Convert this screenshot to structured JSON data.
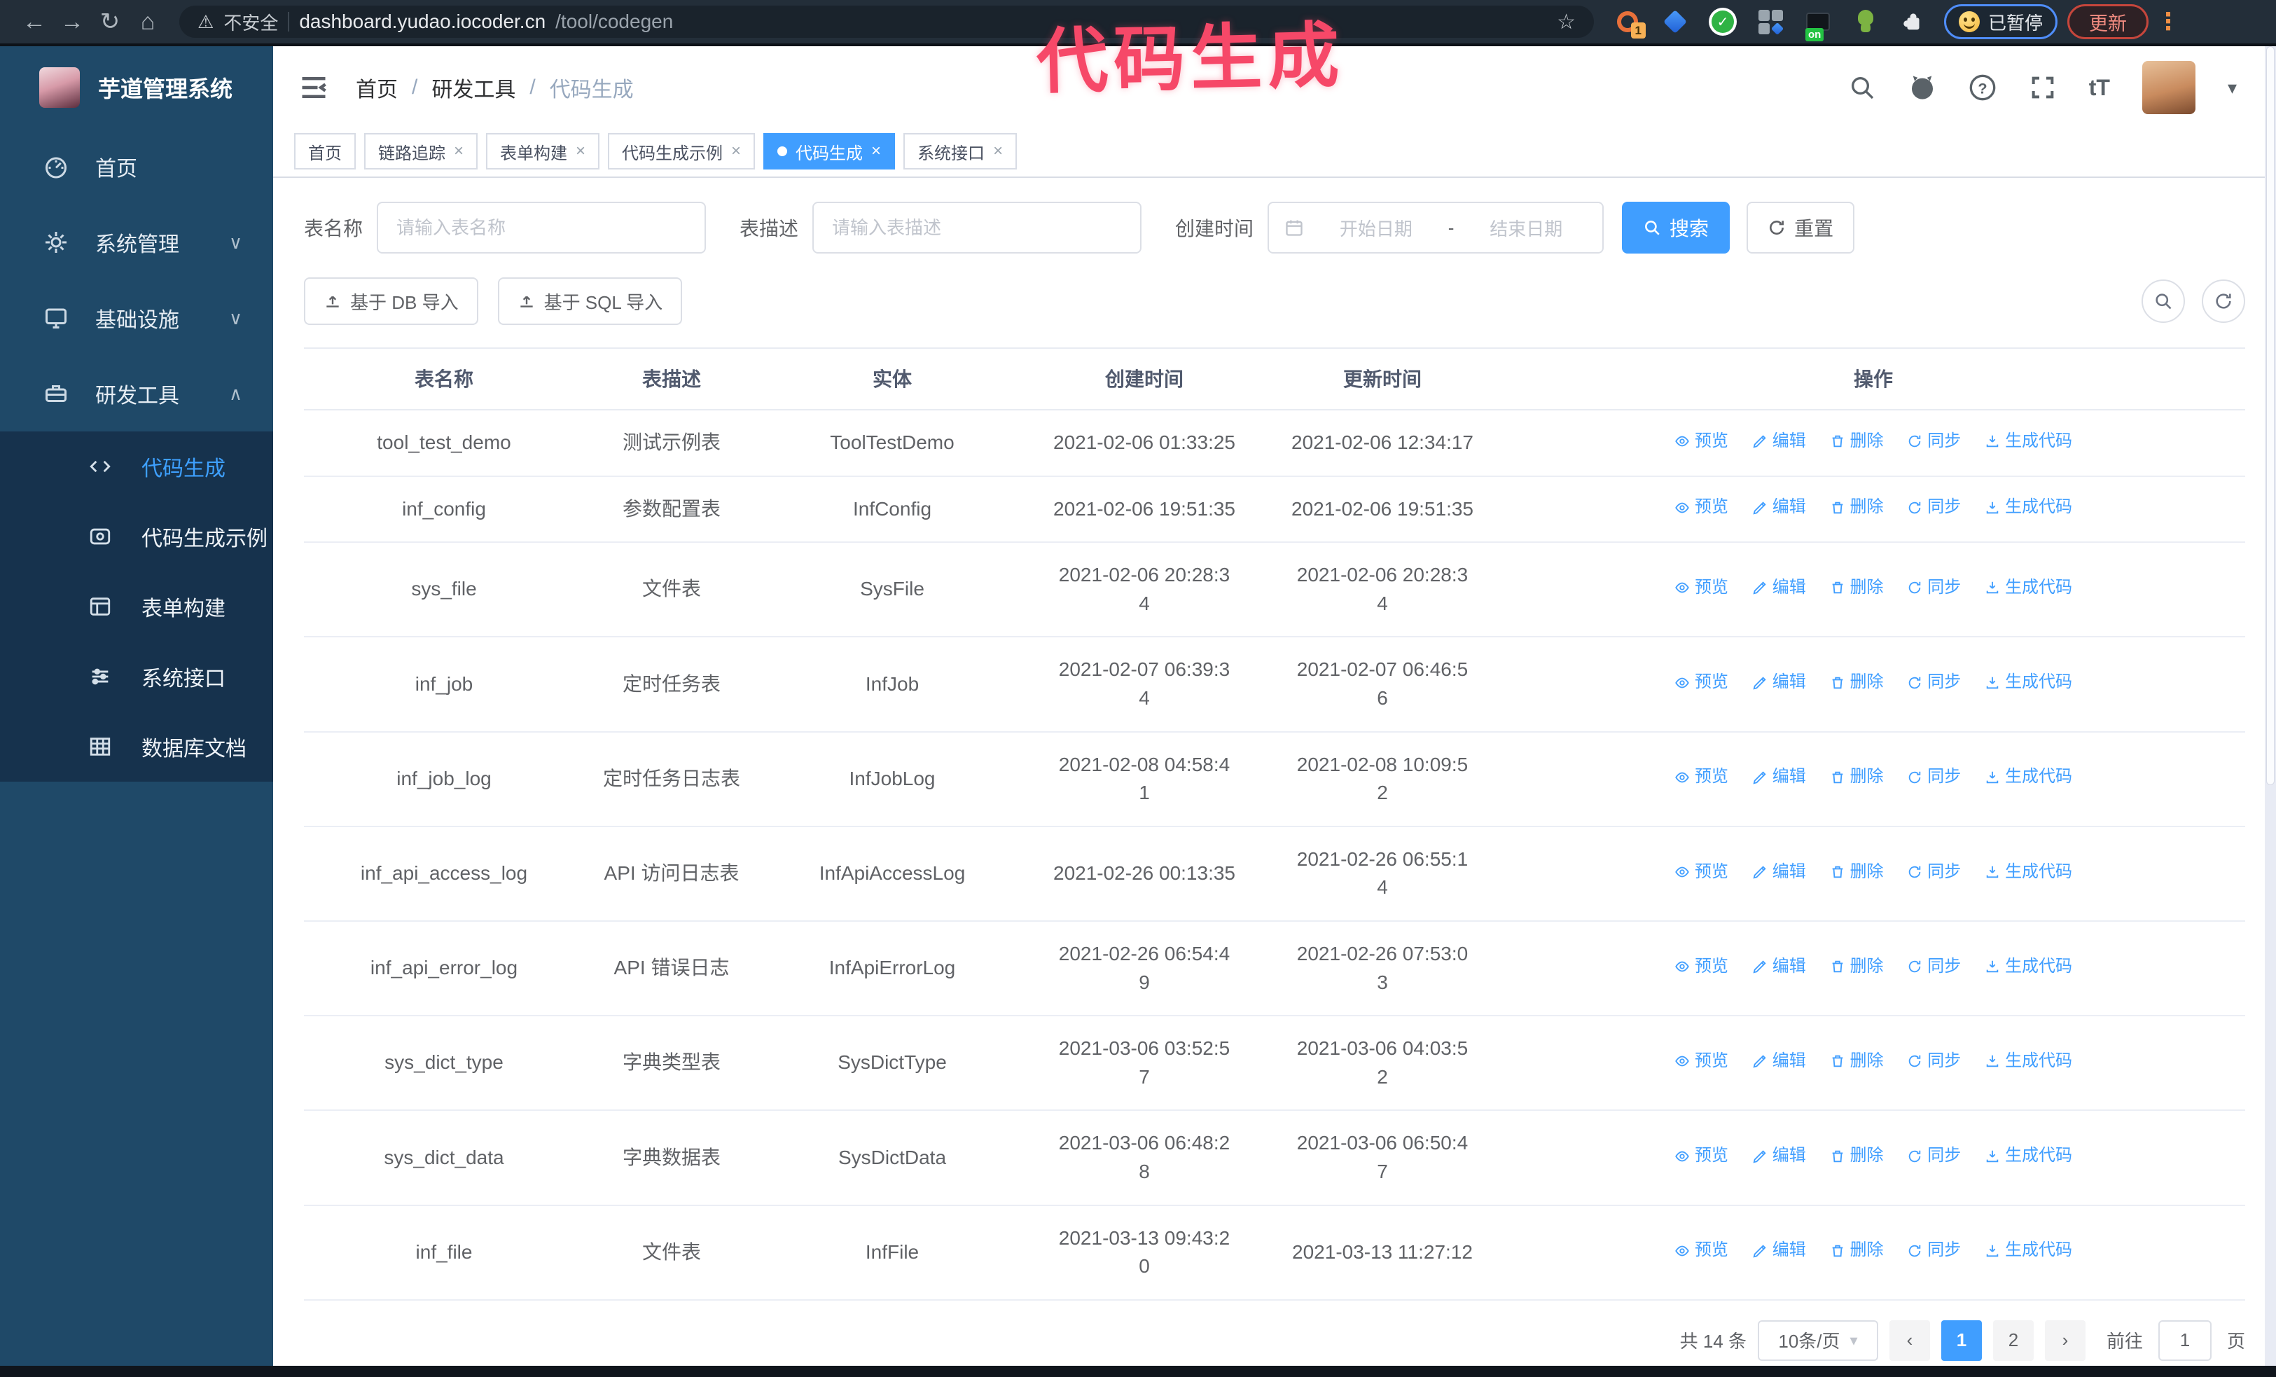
{
  "browser": {
    "security_label": "不安全",
    "url_domain": "dashboard.yudao.iocoder.cn",
    "url_path": "/tool/codegen",
    "extension_badge_count": "1",
    "extension_badge_on": "on",
    "extension_check": "✓",
    "paused_badge": "已暂停",
    "update_button": "更新"
  },
  "watermark": "代码生成",
  "app": {
    "title": "芋道管理系统",
    "breadcrumb": [
      "首页",
      "研发工具",
      "代码生成"
    ]
  },
  "sidebar": {
    "items": [
      {
        "label": "首页"
      },
      {
        "label": "系统管理"
      },
      {
        "label": "基础设施"
      },
      {
        "label": "研发工具"
      }
    ],
    "subitems": [
      {
        "label": "代码生成"
      },
      {
        "label": "代码生成示例"
      },
      {
        "label": "表单构建"
      },
      {
        "label": "系统接口"
      },
      {
        "label": "数据库文档"
      }
    ]
  },
  "tabs": [
    {
      "label": "首页"
    },
    {
      "label": "链路追踪"
    },
    {
      "label": "表单构建"
    },
    {
      "label": "代码生成示例"
    },
    {
      "label": "代码生成"
    },
    {
      "label": "系统接口"
    }
  ],
  "filters": {
    "table_name_label": "表名称",
    "table_name_placeholder": "请输入表名称",
    "table_desc_label": "表描述",
    "table_desc_placeholder": "请输入表描述",
    "create_time_label": "创建时间",
    "date_start_placeholder": "开始日期",
    "date_separator": "-",
    "date_end_placeholder": "结束日期",
    "search_button": "搜索",
    "reset_button": "重置"
  },
  "toolbar": {
    "import_db": "基于 DB 导入",
    "import_sql": "基于 SQL 导入"
  },
  "table": {
    "headers": [
      "表名称",
      "表描述",
      "实体",
      "创建时间",
      "更新时间",
      "操作"
    ],
    "actions": [
      "预览",
      "编辑",
      "删除",
      "同步",
      "生成代码"
    ],
    "rows": [
      {
        "name": "tool_test_demo",
        "desc": "测试示例表",
        "entity": "ToolTestDemo",
        "created": "2021-02-06 01:33:25",
        "updated": "2021-02-06 12:34:17"
      },
      {
        "name": "inf_config",
        "desc": "参数配置表",
        "entity": "InfConfig",
        "created": "2021-02-06 19:51:35",
        "updated": "2021-02-06 19:51:35"
      },
      {
        "name": "sys_file",
        "desc": "文件表",
        "entity": "SysFile",
        "created": "2021-02-06 20:28:3\n4",
        "updated": "2021-02-06 20:28:3\n4"
      },
      {
        "name": "inf_job",
        "desc": "定时任务表",
        "entity": "InfJob",
        "created": "2021-02-07 06:39:3\n4",
        "updated": "2021-02-07 06:46:5\n6"
      },
      {
        "name": "inf_job_log",
        "desc": "定时任务日志表",
        "entity": "InfJobLog",
        "created": "2021-02-08 04:58:4\n1",
        "updated": "2021-02-08 10:09:5\n2"
      },
      {
        "name": "inf_api_access_log",
        "desc": "API 访问日志表",
        "entity": "InfApiAccessLog",
        "created": "2021-02-26 00:13:35",
        "updated": "2021-02-26 06:55:1\n4"
      },
      {
        "name": "inf_api_error_log",
        "desc": "API 错误日志",
        "entity": "InfApiErrorLog",
        "created": "2021-02-26 06:54:4\n9",
        "updated": "2021-02-26 07:53:0\n3"
      },
      {
        "name": "sys_dict_type",
        "desc": "字典类型表",
        "entity": "SysDictType",
        "created": "2021-03-06 03:52:5\n7",
        "updated": "2021-03-06 04:03:5\n2"
      },
      {
        "name": "sys_dict_data",
        "desc": "字典数据表",
        "entity": "SysDictData",
        "created": "2021-03-06 06:48:2\n8",
        "updated": "2021-03-06 06:50:4\n7"
      },
      {
        "name": "inf_file",
        "desc": "文件表",
        "entity": "InfFile",
        "created": "2021-03-13 09:43:2\n0",
        "updated": "2021-03-13 11:27:12"
      }
    ]
  },
  "pagination": {
    "total": "共 14 条",
    "page_size": "10条/页",
    "page_1": "1",
    "page_2": "2",
    "goto_label": "前往",
    "goto_value": "1",
    "page_unit": "页"
  },
  "colors": {
    "accent": "#409eff",
    "watermark": "#f64868",
    "sidebar_bg": "#1f4968",
    "submenu_bg": "#16324d",
    "chrome_bg": "#232e39"
  }
}
